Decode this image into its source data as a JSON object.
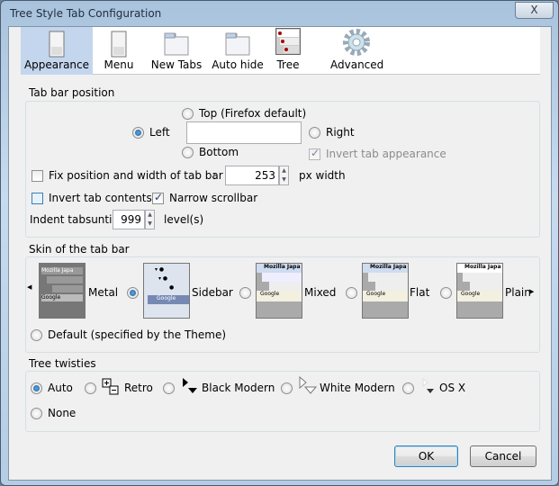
{
  "window": {
    "title": "Tree Style Tab Configuration",
    "close_label": "X"
  },
  "toolbar": {
    "items": [
      {
        "label": "Appearance",
        "icon": "window-icon",
        "selected": true
      },
      {
        "label": "Menu",
        "icon": "window-icon"
      },
      {
        "label": "New Tabs",
        "icon": "folder-icon"
      },
      {
        "label": "Auto hide",
        "icon": "folder-icon"
      },
      {
        "label": "Tree",
        "icon": "tree-tabs-icon"
      },
      {
        "label": "Advanced",
        "icon": "gear-icon"
      }
    ]
  },
  "tabbar_position": {
    "label": "Tab bar position",
    "top": "Top (Firefox default)",
    "left": "Left",
    "right": "Right",
    "bottom": "Bottom",
    "selected": "Left",
    "invert_appearance": "Invert tab appearance",
    "fix_label": "Fix position and width of tab bar",
    "colon": ":",
    "width_value": "253",
    "width_unit": "px width",
    "invert_contents": "Invert tab contents",
    "narrow_scrollbar": "Narrow scrollbar",
    "indent_label": "Indent tabsuntil",
    "indent_value": "999",
    "indent_unit": "level(s)"
  },
  "skin": {
    "label": "Skin of the tab bar",
    "options": [
      "Metal",
      "Sidebar",
      "Mixed",
      "Flat",
      "Plain"
    ],
    "selected": "Sidebar",
    "thumb_text": {
      "mozilla": "Mozilla Japa",
      "google": "Google"
    },
    "default": "Default (specified by the Theme)"
  },
  "twisties": {
    "label": "Tree twisties",
    "options": [
      "Auto",
      "Retro",
      "Black Modern",
      "White Modern",
      "OS X",
      "None"
    ],
    "selected": "Auto"
  },
  "buttons": {
    "ok": "OK",
    "cancel": "Cancel"
  },
  "colors": {
    "selected_tab": "#c4d6ee",
    "frame": "#b5cde4"
  }
}
